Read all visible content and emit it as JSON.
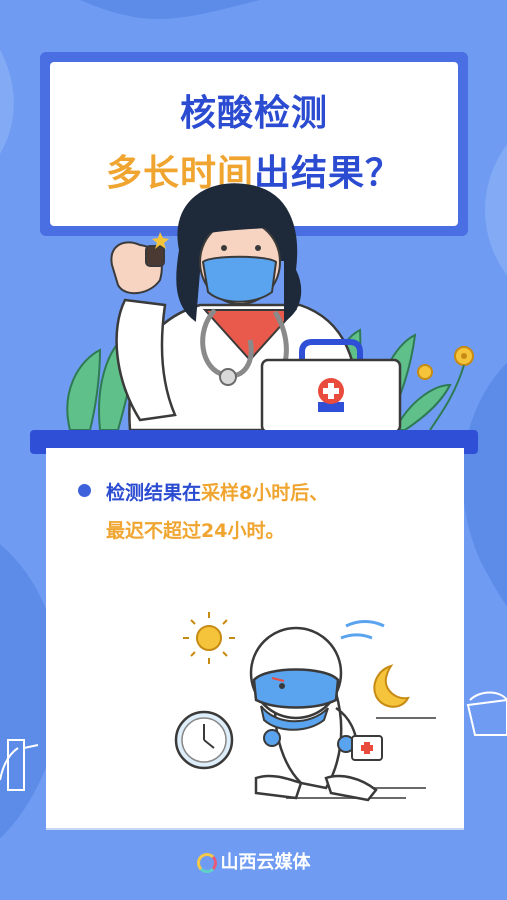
{
  "title": {
    "line1": "核酸检测",
    "line2_part1": "多长时间",
    "line2_part2": "出结果？"
  },
  "content": {
    "line1_part1": "检测结果在",
    "line1_part2": "采样8小时后、",
    "line2": "最迟不超过24小时。"
  },
  "footer": {
    "brand": "山西云媒体"
  },
  "colors": {
    "background": "#6f9cf2",
    "accent_blue": "#2b4bd1",
    "accent_orange": "#f0a531"
  }
}
